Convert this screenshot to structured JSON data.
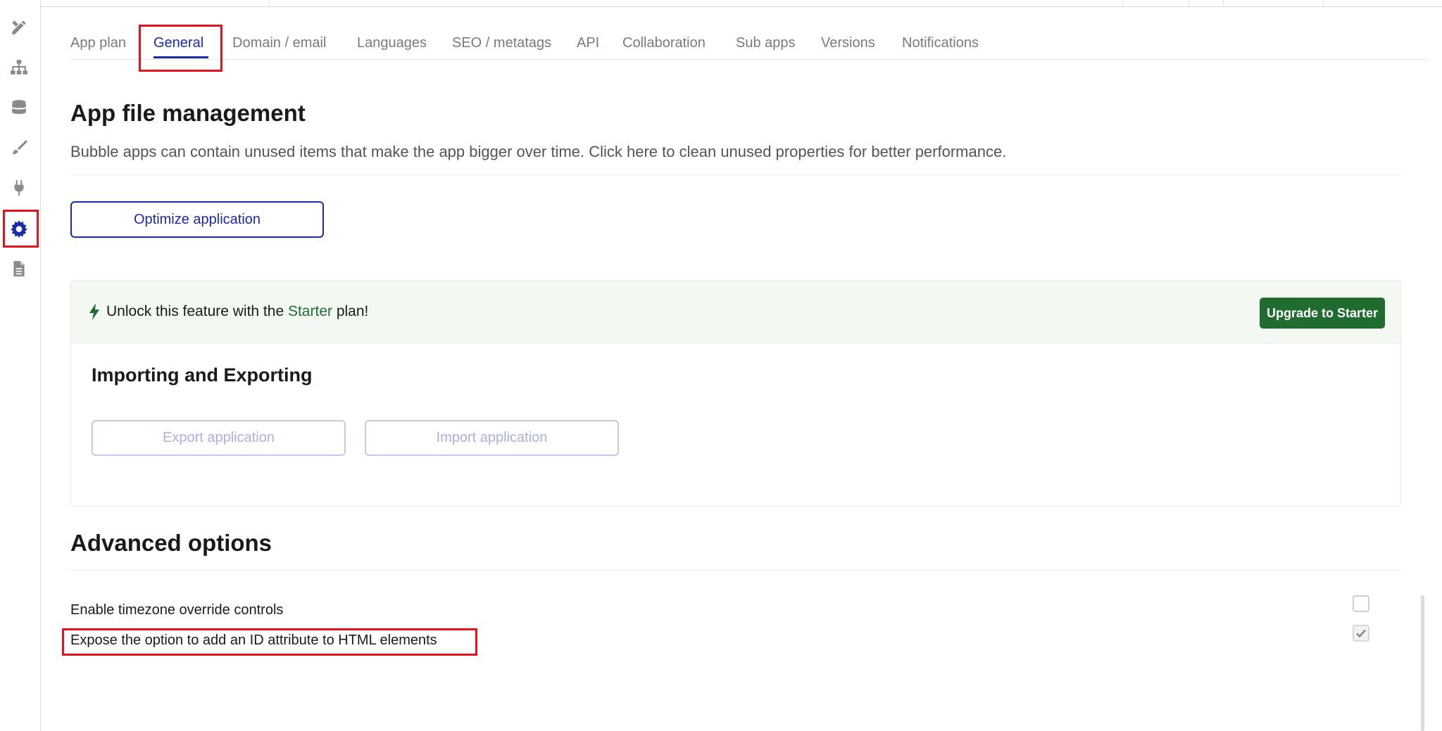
{
  "sidebar": {
    "items": [
      {
        "name": "design-tab",
        "icon": "pencil-ruler-icon"
      },
      {
        "name": "workflow-tab",
        "icon": "sitemap-icon"
      },
      {
        "name": "data-tab",
        "icon": "database-icon"
      },
      {
        "name": "styles-tab",
        "icon": "paintbrush-icon"
      },
      {
        "name": "plugins-tab",
        "icon": "plug-icon"
      },
      {
        "name": "settings-tab",
        "icon": "gear-icon",
        "active": true
      },
      {
        "name": "logs-tab",
        "icon": "document-icon"
      }
    ]
  },
  "tabs": [
    {
      "label": "App plan"
    },
    {
      "label": "General",
      "active": true
    },
    {
      "label": "Domain / email"
    },
    {
      "label": "Languages"
    },
    {
      "label": "SEO / metatags"
    },
    {
      "label": "API"
    },
    {
      "label": "Collaboration"
    },
    {
      "label": "Sub apps"
    },
    {
      "label": "Versions"
    },
    {
      "label": "Notifications"
    }
  ],
  "file_management": {
    "title": "App file management",
    "description": "Bubble apps can contain unused items that make the app bigger over time. Click here to clean unused properties for better performance.",
    "optimize_button": "Optimize application"
  },
  "unlock": {
    "text_prefix": "Unlock this feature with the ",
    "plan_name": "Starter",
    "text_suffix": " plan!",
    "upgrade_button": "Upgrade to Starter"
  },
  "import_export": {
    "title": "Importing and Exporting",
    "export_button": "Export application",
    "import_button": "Import application"
  },
  "advanced": {
    "title": "Advanced options",
    "options": [
      {
        "label": "Enable timezone override controls",
        "checked": false
      },
      {
        "label": "Expose the option to add an ID attribute to HTML elements",
        "checked": true
      }
    ]
  },
  "colors": {
    "accent": "#1b2aa8",
    "upgrade_green": "#1f6b30",
    "highlight_red": "#e3141b"
  }
}
